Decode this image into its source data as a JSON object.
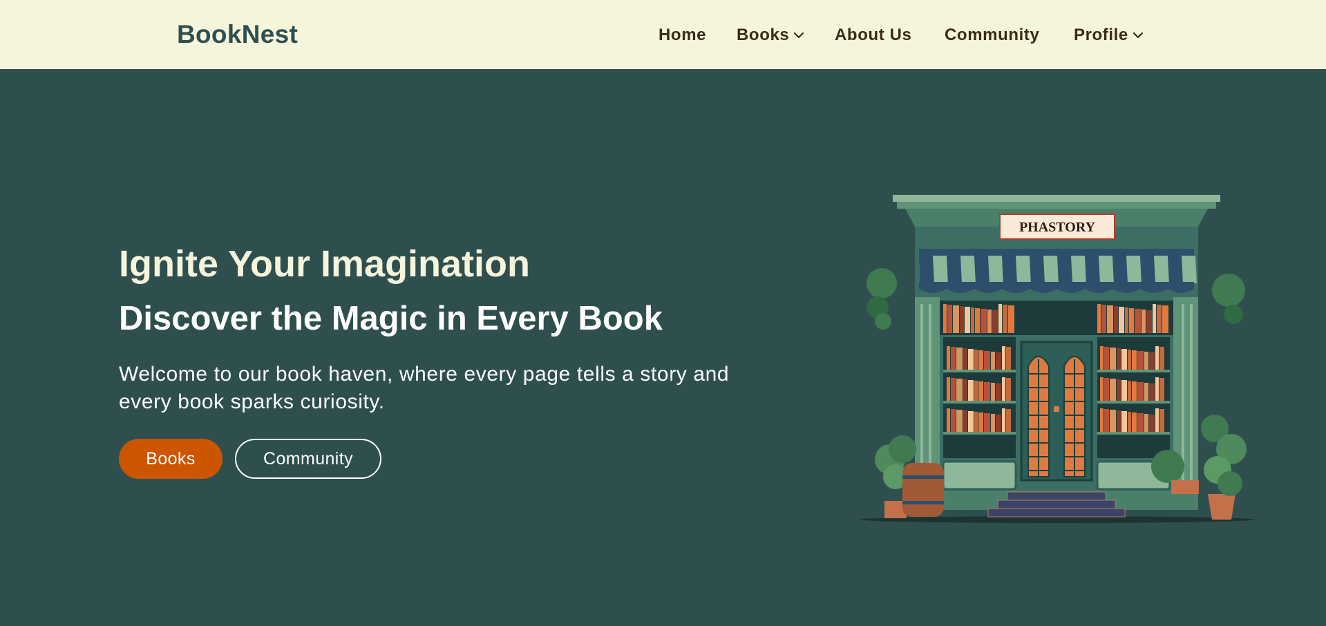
{
  "header": {
    "logo": "BookNest",
    "nav": [
      {
        "label": "Home",
        "has_dropdown": false
      },
      {
        "label": "Books",
        "has_dropdown": true
      },
      {
        "label": "About Us",
        "has_dropdown": false
      },
      {
        "label": "Community",
        "has_dropdown": false
      },
      {
        "label": "Profile",
        "has_dropdown": true
      }
    ]
  },
  "hero": {
    "title": "Ignite Your Imagination",
    "subtitle": "Discover the Magic in Every Book",
    "description": "Welcome to our book haven, where every page tells a story and every book sparks curiosity.",
    "primary_button": "Books",
    "secondary_button": "Community",
    "illustration": {
      "sign_text": "PHASTORY"
    }
  },
  "colors": {
    "header_bg": "#f5f5dc",
    "hero_bg": "#2f4f4f",
    "accent": "#cc5500",
    "title_color": "#f5f5dc",
    "nav_text": "#3b2a1a"
  },
  "icons": {
    "dropdown": "chevron-down-icon"
  }
}
